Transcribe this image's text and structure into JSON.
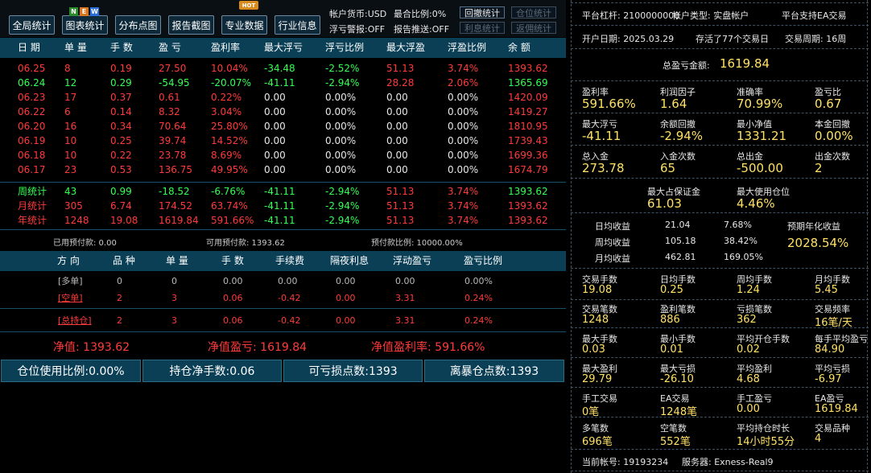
{
  "toolbar": {
    "buttons": [
      "全局统计",
      "图表统计",
      "分布点图",
      "报告截图",
      "专业数据",
      "行业信息"
    ],
    "new_badges": [
      "N",
      "E",
      "W"
    ],
    "hot_label": "HOT",
    "account_currency": "帐户货币:USD",
    "position_ratio": "最合比例:0%",
    "float_loss_alert": "浮亏警报:OFF",
    "report_push": "报告推送:OFF",
    "small_buttons": [
      "回撤统计",
      "仓位统计",
      "利息统计",
      "返佣统计"
    ]
  },
  "table": {
    "headers": [
      "日 期",
      "单 量",
      "手 数",
      "盈 亏",
      "盈利率",
      "最大浮亏",
      "浮亏比例",
      "最大浮盈",
      "浮盈比例",
      "余 额"
    ],
    "rows": [
      {
        "date": "06.25",
        "orders": "8",
        "lots": "0.19",
        "pnl": "27.50",
        "rate": "10.04%",
        "max_loss": "-34.48",
        "loss_ratio": "-2.52%",
        "max_gain": "51.13",
        "gain_ratio": "3.74%",
        "balance": "1393.62",
        "color": "red"
      },
      {
        "date": "06.24",
        "orders": "12",
        "lots": "0.29",
        "pnl": "-54.95",
        "rate": "-20.07%",
        "max_loss": "-41.11",
        "loss_ratio": "-2.94%",
        "max_gain": "28.28",
        "gain_ratio": "2.06%",
        "balance": "1365.69",
        "color": "green"
      },
      {
        "date": "06.23",
        "orders": "17",
        "lots": "0.37",
        "pnl": "0.61",
        "rate": "0.22%",
        "max_loss": "0.00",
        "loss_ratio": "0.00%",
        "max_gain": "0.00",
        "gain_ratio": "0.00%",
        "balance": "1420.09",
        "color": "red"
      },
      {
        "date": "06.22",
        "orders": "6",
        "lots": "0.14",
        "pnl": "8.32",
        "rate": "3.04%",
        "max_loss": "0.00",
        "loss_ratio": "0.00%",
        "max_gain": "0.00",
        "gain_ratio": "0.00%",
        "balance": "1419.27",
        "color": "red"
      },
      {
        "date": "06.20",
        "orders": "16",
        "lots": "0.34",
        "pnl": "70.64",
        "rate": "25.80%",
        "max_loss": "0.00",
        "loss_ratio": "0.00%",
        "max_gain": "0.00",
        "gain_ratio": "0.00%",
        "balance": "1810.95",
        "color": "red"
      },
      {
        "date": "06.19",
        "orders": "10",
        "lots": "0.25",
        "pnl": "39.74",
        "rate": "14.52%",
        "max_loss": "0.00",
        "loss_ratio": "0.00%",
        "max_gain": "0.00",
        "gain_ratio": "0.00%",
        "balance": "1739.43",
        "color": "red"
      },
      {
        "date": "06.18",
        "orders": "10",
        "lots": "0.22",
        "pnl": "23.78",
        "rate": "8.69%",
        "max_loss": "0.00",
        "loss_ratio": "0.00%",
        "max_gain": "0.00",
        "gain_ratio": "0.00%",
        "balance": "1699.36",
        "color": "red"
      },
      {
        "date": "06.17",
        "orders": "23",
        "lots": "0.53",
        "pnl": "136.75",
        "rate": "49.95%",
        "max_loss": "0.00",
        "loss_ratio": "0.00%",
        "max_gain": "0.00",
        "gain_ratio": "0.00%",
        "balance": "1674.79",
        "color": "red"
      }
    ],
    "summary": [
      {
        "date": "周统计",
        "orders": "43",
        "lots": "0.99",
        "pnl": "-18.52",
        "rate": "-6.76%",
        "max_loss": "-41.11",
        "loss_ratio": "-2.94%",
        "max_gain": "51.13",
        "gain_ratio": "3.74%",
        "balance": "1393.62",
        "color": "green"
      },
      {
        "date": "月统计",
        "orders": "305",
        "lots": "6.74",
        "pnl": "174.52",
        "rate": "63.74%",
        "max_loss": "-41.11",
        "loss_ratio": "-2.94%",
        "max_gain": "51.13",
        "gain_ratio": "3.74%",
        "balance": "1393.62",
        "color": "red"
      },
      {
        "date": "年统计",
        "orders": "1248",
        "lots": "19.08",
        "pnl": "1619.84",
        "rate": "591.66%",
        "max_loss": "-41.11",
        "loss_ratio": "-2.94%",
        "max_gain": "51.13",
        "gain_ratio": "3.74%",
        "balance": "1393.62",
        "color": "red"
      }
    ]
  },
  "prepay": {
    "used": "已用预付款: 0.00",
    "available": "可用预付款: 1393.62",
    "ratio": "预付款比例: 10000.00%"
  },
  "positions": {
    "headers": [
      "方 向",
      "品 种",
      "单 量",
      "手 数",
      "手续费",
      "隔夜利息",
      "浮动盈亏",
      "盈亏比例"
    ],
    "rows": [
      {
        "dir": "[多单]",
        "symbols": "0",
        "orders": "0",
        "lots": "0.00",
        "fee": "0.00",
        "swap": "0.00",
        "float": "0.00",
        "ratio": "0.00%",
        "color": "gray"
      },
      {
        "dir": "[空单]",
        "symbols": "2",
        "orders": "3",
        "lots": "0.06",
        "fee": "-0.42",
        "swap": "0.00",
        "float": "3.31",
        "ratio": "0.24%",
        "color": "red"
      },
      {
        "dir": "[总持仓]",
        "symbols": "2",
        "orders": "3",
        "lots": "0.06",
        "fee": "-0.42",
        "swap": "0.00",
        "float": "3.31",
        "ratio": "0.24%",
        "color": "red"
      }
    ]
  },
  "netline": {
    "net_label": "净值:",
    "net_value": "1393.62",
    "pnl_label": "净值盈亏:",
    "pnl_value": "1619.84",
    "rate_label": "净值盈利率:",
    "rate_value": "591.66%"
  },
  "bottom_bar": [
    "仓位使用比例:0.00%",
    "持仓净手数:0.06",
    "可亏损点数:1393",
    "离暴仓点数:1393"
  ],
  "right": {
    "leverage": "平台杠杆: 2100000000",
    "account_type": "帐户类型: 实盘帐户",
    "ea_support": "平台支持EA交易",
    "open_date": "开户日期: 2025.03.29",
    "alive": "存活了77个交易日",
    "cycle": "交易周期: 16周",
    "total_pnl_label": "总盈亏金额:",
    "total_pnl_value": "1619.84",
    "grid1": [
      {
        "label": "盈利率",
        "value": "591.66%"
      },
      {
        "label": "利润因子",
        "value": "1.64"
      },
      {
        "label": "准确率",
        "value": "70.99%"
      },
      {
        "label": "盈亏比",
        "value": "0.67"
      },
      {
        "label": "最大浮亏",
        "value": "-41.11"
      },
      {
        "label": "余额回撤",
        "value": "-2.94%"
      },
      {
        "label": "最小净值",
        "value": "1331.21"
      },
      {
        "label": "本金回撤",
        "value": "0.00%"
      },
      {
        "label": "总入金",
        "value": "273.78"
      },
      {
        "label": "入金次数",
        "value": "65"
      },
      {
        "label": "总出金",
        "value": "-500.00"
      },
      {
        "label": "出金次数",
        "value": "2"
      }
    ],
    "margin_label": "最大占保证金",
    "margin_value": "61.03",
    "max_pos_label": "最大使用仓位",
    "max_pos_value": "4.46%",
    "income": [
      {
        "label": "日均收益",
        "value": "21.04",
        "pct": "7.68%"
      },
      {
        "label": "周均收益",
        "value": "105.18",
        "pct": "38.42%"
      },
      {
        "label": "月均收益",
        "value": "462.81",
        "pct": "169.05%"
      }
    ],
    "annual_label": "预期年化收益",
    "annual_value": "2028.54%",
    "grid2": [
      {
        "label": "交易手数",
        "value": "19.08"
      },
      {
        "label": "日均手数",
        "value": "0.25"
      },
      {
        "label": "周均手数",
        "value": "1.24"
      },
      {
        "label": "月均手数",
        "value": "5.45"
      },
      {
        "label": "交易笔数",
        "value": "1248"
      },
      {
        "label": "盈利笔数",
        "value": "886"
      },
      {
        "label": "亏损笔数",
        "value": "362"
      },
      {
        "label": "交易频率",
        "value": "16笔/天"
      },
      {
        "label": "最大手数",
        "value": "0.03"
      },
      {
        "label": "最小手数",
        "value": "0.01"
      },
      {
        "label": "平均开仓手数",
        "value": "0.02"
      },
      {
        "label": "每手平均盈亏",
        "value": "84.90"
      },
      {
        "label": "最大盈利",
        "value": "29.79"
      },
      {
        "label": "最大亏损",
        "value": "-26.10"
      },
      {
        "label": "平均盈利",
        "value": "4.68"
      },
      {
        "label": "平均亏损",
        "value": "-6.97"
      },
      {
        "label": "手工交易",
        "value": "0笔"
      },
      {
        "label": "EA交易",
        "value": "1248笔"
      },
      {
        "label": "手工盈亏",
        "value": "0.00"
      },
      {
        "label": "EA盈亏",
        "value": "1619.84"
      },
      {
        "label": "多笔数",
        "value": "696笔"
      },
      {
        "label": "空笔数",
        "value": "552笔"
      },
      {
        "label": "平均持仓时长",
        "value": "14小时55分"
      },
      {
        "label": "交易品种",
        "value": "4"
      }
    ],
    "account_no": "当前帐号: 19193234",
    "server": "服务器: Exness-Real9"
  },
  "colors": {
    "red": "#ff3b3b",
    "green": "#33ff55",
    "yellow": "#ffe066",
    "header_bg": "#0a3f56"
  }
}
